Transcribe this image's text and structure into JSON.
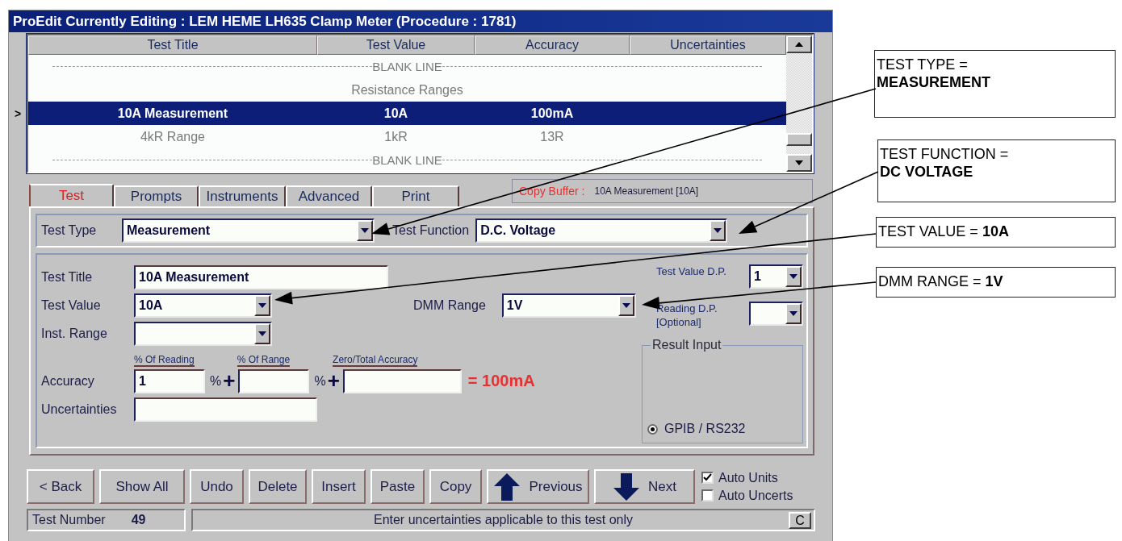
{
  "window": {
    "title": "ProEdit Currently Editing : LEM HEME LH635 Clamp Meter (Procedure : 1781)"
  },
  "table": {
    "columns": [
      "Test Title",
      "Test Value",
      "Accuracy",
      "Uncertainties"
    ],
    "row_marker": ">",
    "rows": [
      {
        "kind": "blank",
        "text": "BLANK LINE",
        "selected": false
      },
      {
        "kind": "heading",
        "text": "Resistance Ranges",
        "selected": false
      },
      {
        "kind": "test",
        "cells": [
          "10A Measurement",
          "10A",
          "100mA"
        ],
        "selected": true
      },
      {
        "kind": "test",
        "cells": [
          "4kR Range",
          "1kR",
          "13R"
        ],
        "selected": false
      },
      {
        "kind": "blank",
        "text": "BLANK LINE",
        "selected": false
      }
    ]
  },
  "tabs": [
    {
      "label": "Test",
      "selected": true
    },
    {
      "label": "Prompts",
      "selected": false
    },
    {
      "label": "Instruments",
      "selected": false
    },
    {
      "label": "Advanced",
      "selected": false
    },
    {
      "label": "Print",
      "selected": false
    }
  ],
  "copy_buffer": {
    "label": "Copy Buffer :",
    "value": "10A Measurement  [10A]"
  },
  "test_type": {
    "label": "Test Type",
    "value": "Measurement"
  },
  "test_function": {
    "label": "Test Function",
    "value": "D.C. Voltage"
  },
  "form": {
    "test_title": {
      "label": "Test Title",
      "value": "10A Measurement"
    },
    "test_value": {
      "label": "Test Value",
      "value": "10A"
    },
    "dmm_range": {
      "label": "DMM Range",
      "value": "1V"
    },
    "inst_range": {
      "label": "Inst. Range"
    },
    "accuracy": {
      "label": "Accuracy",
      "captions": [
        "% Of Reading",
        "% Of Range",
        "Zero/Total Accuracy"
      ],
      "values": [
        "1"
      ],
      "units": [
        "%",
        "+",
        "%",
        "+"
      ],
      "result": "= 100mA"
    },
    "uncertainties": {
      "label": "Uncertainties"
    },
    "test_value_dp": {
      "label": "Test Value D.P.",
      "value": "1"
    },
    "reading_dp": {
      "label": "Reading D.P. [Optional]"
    },
    "result_input": {
      "title": "Result Input",
      "options": [
        {
          "label": "GPIB / RS232",
          "selected": true
        }
      ]
    }
  },
  "buttons": [
    {
      "label": "< Back",
      "kind": "plain"
    },
    {
      "label": "Show All",
      "kind": "plain"
    },
    {
      "label": "Undo",
      "kind": "plain"
    },
    {
      "label": "Delete",
      "kind": "plain"
    },
    {
      "label": "Insert",
      "kind": "plain"
    },
    {
      "label": "Paste",
      "kind": "plain"
    },
    {
      "label": "Copy",
      "kind": "plain"
    },
    {
      "label": "Previous",
      "kind": "up"
    },
    {
      "label": "Next",
      "kind": "down"
    }
  ],
  "checkboxes": [
    {
      "label": "Auto Units",
      "checked": true
    },
    {
      "label": "Auto Uncerts",
      "checked": false
    }
  ],
  "status_bar": {
    "test_number_label": "Test Number",
    "test_number": "49",
    "message": "Enter uncertainties applicable to this test only",
    "button": "C"
  },
  "annotations": [
    {
      "kind": "stacked",
      "label": "TEST TYPE =",
      "value": "MEASUREMENT"
    },
    {
      "kind": "stacked",
      "label": "TEST FUNCTION =",
      "value": "DC VOLTAGE"
    },
    {
      "kind": "inline",
      "label": "TEST VALUE =",
      "value": "10A"
    },
    {
      "kind": "inline",
      "label": "DMM RANGE =",
      "value": "1V"
    }
  ]
}
